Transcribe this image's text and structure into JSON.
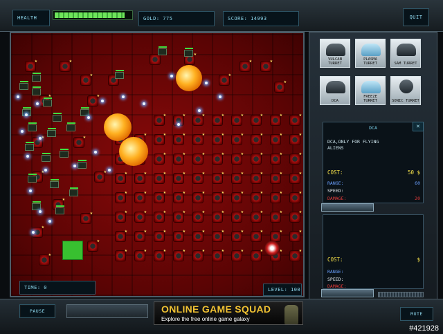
{
  "hud": {
    "health_label": "HEALTH",
    "health_fraction": 0.92,
    "gold_text": "GOLD: 775",
    "score_text": "SCORE: 14993",
    "quit_label": "QUIT",
    "time_text": "TIME:   0",
    "level_text": "LEVEL: 100"
  },
  "towers": [
    {
      "label": "VULCAN TURRET",
      "icon": "vulcan-turret-icon"
    },
    {
      "label": "PLASMA TURRET",
      "icon": "plasma-turret-icon"
    },
    {
      "label": "SAM TURRET",
      "icon": "sam-turret-icon"
    },
    {
      "label": "DCA",
      "icon": "dca-turret-icon"
    },
    {
      "label": "FREEZE TURRET",
      "icon": "freeze-turret-icon"
    },
    {
      "label": "SONIC TURRET",
      "icon": "sonic-turret-icon"
    }
  ],
  "info": {
    "title": "DCA",
    "close": "✕",
    "description": "DCA,ONLY FOR FLYING\nALIENS",
    "cost_label": "COST:",
    "cost_value": "50 $",
    "range_label": "RANGE:",
    "range_value": "60",
    "speed_label": "SPEED:",
    "speed_value": "",
    "damage_label": "DAMAGE:",
    "damage_value": "20"
  },
  "info2": {
    "cost_label": "COST:",
    "cost_value": "$",
    "range_label": "RANGE:",
    "speed_label": "SPEED:",
    "damage_label": "DAMAGE:"
  },
  "bottom": {
    "pause_label": "PAUSE",
    "mute_label": "MUTE",
    "ad_title": "ONLINE GAME SQUAD",
    "ad_subtitle": "Explore the free online game galaxy"
  },
  "watermark": "#421928",
  "colors": {
    "field": "#6a0606",
    "cost": "#f6e24a",
    "range": "#6aa0ff",
    "damage": "#e03a3a",
    "health": "#6ee55a"
  }
}
